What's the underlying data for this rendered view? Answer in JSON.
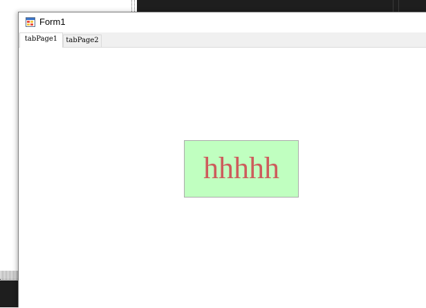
{
  "window": {
    "title": "Form1",
    "icon": "windows-form-icon"
  },
  "tabs": [
    {
      "label": "tabPage1",
      "selected": true
    },
    {
      "label": "tabPage2",
      "selected": false
    }
  ],
  "content": {
    "label_text": "hhhhh",
    "label_background": "#c0ffc0",
    "label_text_color": "#cd5c5c"
  }
}
